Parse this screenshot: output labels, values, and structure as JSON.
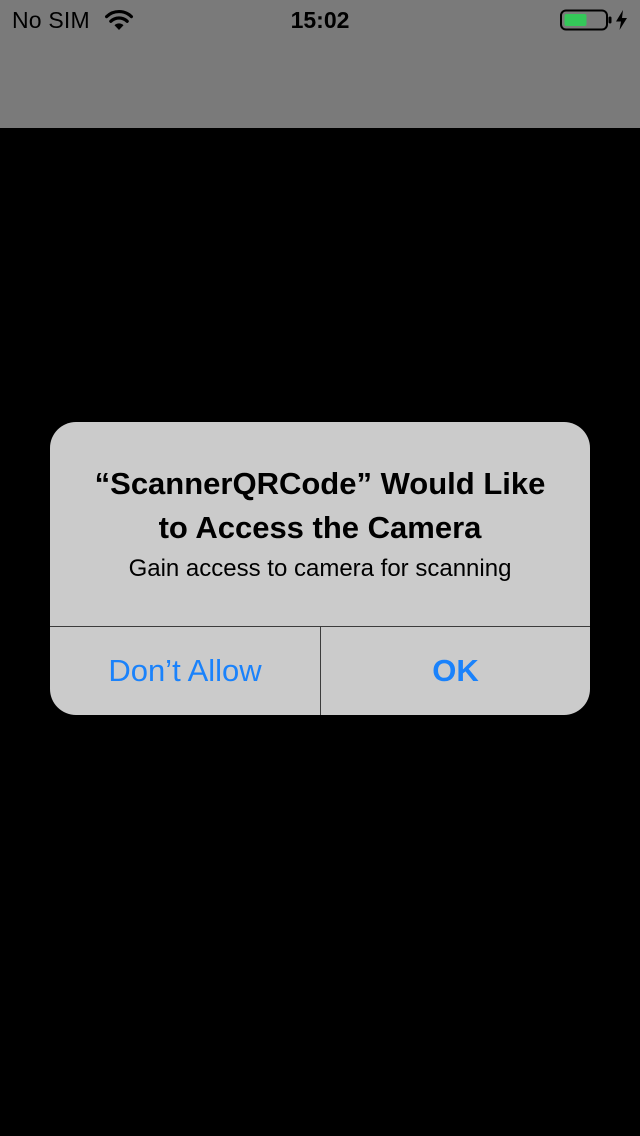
{
  "status_bar": {
    "carrier": "No SIM",
    "time": "15:02",
    "wifi_icon": "wifi-icon",
    "battery_icon": "battery-charging-icon",
    "battery_color": "#34c759"
  },
  "alert": {
    "title": "“ScannerQRCode” Would Like to Access the Camera",
    "message": "Gain access to camera for scanning",
    "buttons": [
      {
        "label": "Don’t Allow"
      },
      {
        "label": "OK"
      }
    ],
    "button_color": "#1a82fb"
  },
  "colors": {
    "background": "#000000",
    "top_bar": "#7a7a7a",
    "alert_background": "#cbcbcb"
  }
}
